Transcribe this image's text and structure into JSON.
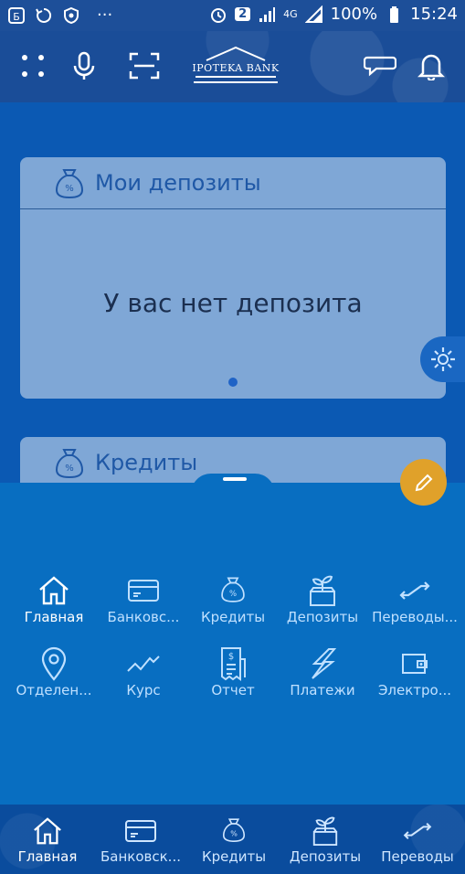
{
  "status_bar": {
    "notification_count": "2",
    "network": "4G",
    "battery": "100%",
    "time": "15:24",
    "more": "···"
  },
  "header": {
    "logo_text": "IPOTEKA BANK"
  },
  "deposits_card": {
    "title": "Мои депозиты",
    "empty_message": "У вас нет депозита"
  },
  "credits_card": {
    "title": "Кредиты"
  },
  "menu": {
    "row1": [
      {
        "label": "Главная",
        "icon": "home-icon"
      },
      {
        "label": "Банковс...",
        "icon": "card-icon"
      },
      {
        "label": "Кредиты",
        "icon": "money-bag-icon"
      },
      {
        "label": "Депозиты",
        "icon": "plant-box-icon"
      },
      {
        "label": "Переводы...",
        "icon": "transfer-icon"
      }
    ],
    "row2": [
      {
        "label": "Отделен...",
        "icon": "location-pin-icon"
      },
      {
        "label": "Курс",
        "icon": "rate-chart-icon"
      },
      {
        "label": "Отчет",
        "icon": "receipt-icon"
      },
      {
        "label": "Платежи",
        "icon": "lightning-icon"
      },
      {
        "label": "Электро...",
        "icon": "wallet-icon"
      }
    ]
  },
  "bottom_nav": [
    {
      "label": "Главная",
      "icon": "home-icon"
    },
    {
      "label": "Банковск...",
      "icon": "card-icon"
    },
    {
      "label": "Кредиты",
      "icon": "money-bag-icon"
    },
    {
      "label": "Депозиты",
      "icon": "plant-box-icon"
    },
    {
      "label": "Переводы",
      "icon": "transfer-icon"
    }
  ],
  "colors": {
    "accent": "#e0a12a",
    "primary": "#0b59b3",
    "card": "#7fa7d6"
  }
}
